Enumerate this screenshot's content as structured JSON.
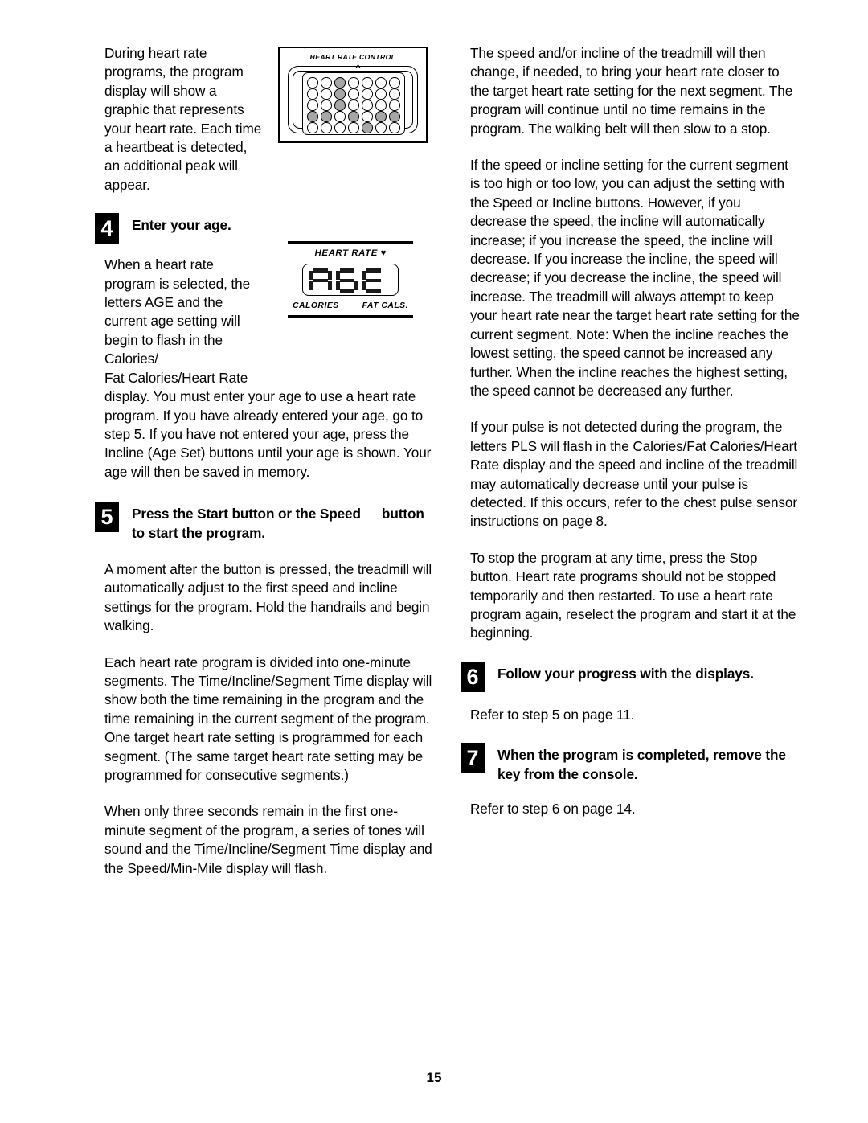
{
  "page": {
    "number": "15"
  },
  "figures": {
    "heart_rate_control": {
      "label": "HEART RATE CONTROL",
      "grid": {
        "columns": 7,
        "rows": 5,
        "filled": [
          [
            0,
            0,
            1,
            0,
            0,
            0,
            0
          ],
          [
            0,
            0,
            1,
            0,
            0,
            0,
            0
          ],
          [
            0,
            0,
            1,
            0,
            0,
            0,
            0
          ],
          [
            1,
            1,
            0,
            1,
            0,
            1,
            1
          ],
          [
            0,
            0,
            0,
            0,
            1,
            0,
            0
          ]
        ],
        "dot_on_color": "#a6a6a6",
        "dot_off_color": "#ffffff"
      }
    },
    "age_display": {
      "top_label": "HEART RATE",
      "heart_glyph": "♥",
      "reading": "AGE",
      "segments": [
        [
          "a",
          "b",
          "c",
          "e",
          "f",
          "g"
        ],
        [
          "a",
          "c",
          "d",
          "e",
          "f",
          "g"
        ],
        [
          "a",
          "d",
          "e",
          "f",
          "g"
        ]
      ],
      "bottom_left_label": "CALORIES",
      "bottom_right_label": "FAT CALS."
    }
  },
  "left_column": {
    "intro_paragraph": "During heart rate programs, the program display will show a graphic that represents your heart rate. Each time a heartbeat is detected, an additional peak will appear.",
    "step4": {
      "number": "4",
      "title": "Enter your age."
    },
    "step4_body_narrow": "When a heart rate program is selected, the letters AGE and the current age setting will begin to flash in the Calories/",
    "step4_body_narrow2": "Fat Calories/Heart Rate",
    "step4_body_rest": "display. You must enter your age to use a heart rate program. If you have already entered your age, go to step 5. If you have not entered your age, press the Incline (Age Set) buttons until your age is shown. Your age will then be saved in memory.",
    "step5": {
      "number": "5",
      "title_part1": "Press the Start button or the Speed",
      "title_part2": "button to start the program."
    },
    "step5_para1": "A moment after the button is pressed, the treadmill will automatically adjust to the first speed and incline settings for the program. Hold the handrails and begin walking.",
    "step5_para2": "Each heart rate program is divided into one-minute segments. The Time/Incline/Segment Time display will show both the time remaining in the program and the time remaining in the current segment of the program. One target heart rate setting is programmed for each segment. (The same target heart rate setting may be programmed for consecutive segments.)",
    "step5_para3": "When only three seconds remain in the first one-minute segment of the program, a series of tones will sound and the Time/Incline/Segment Time display and the Speed/Min-Mile display will flash."
  },
  "right_column": {
    "para1": "The speed and/or incline of the treadmill will then change, if needed, to bring your heart rate closer to the target heart rate setting for the next segment. The program will continue until no time remains in the program. The walking belt will then slow to a stop.",
    "para2": "If the speed or incline setting for the current segment is too high or too low, you can adjust the setting with the Speed or Incline buttons. However, if you decrease the speed, the incline will automatically increase; if you increase the speed, the incline will decrease. If you increase the incline, the speed will decrease; if you decrease the incline, the speed will increase. The treadmill will always attempt to keep your heart rate near the target heart rate setting for the current segment. Note: When the incline reaches the lowest setting, the speed cannot be increased any further. When the incline reaches the highest setting, the speed cannot be decreased any further.",
    "para3": "If your pulse is not detected during the program, the letters PLS will flash in the Calories/Fat Calories/Heart Rate display and the speed and incline of the treadmill may automatically decrease until your pulse is detected. If this occurs, refer to the chest pulse sensor instructions on page 8.",
    "para4": "To stop the program at any time, press the Stop button. Heart rate programs should not be stopped temporarily and then restarted. To use a heart rate program again, reselect the program and start it at the beginning.",
    "step6": {
      "number": "6",
      "title": "Follow your progress with the displays.",
      "body": "Refer to step 5 on page 11."
    },
    "step7": {
      "number": "7",
      "title": "When the program is completed, remove the key from the console.",
      "body": "Refer to step 6 on page 14."
    }
  }
}
